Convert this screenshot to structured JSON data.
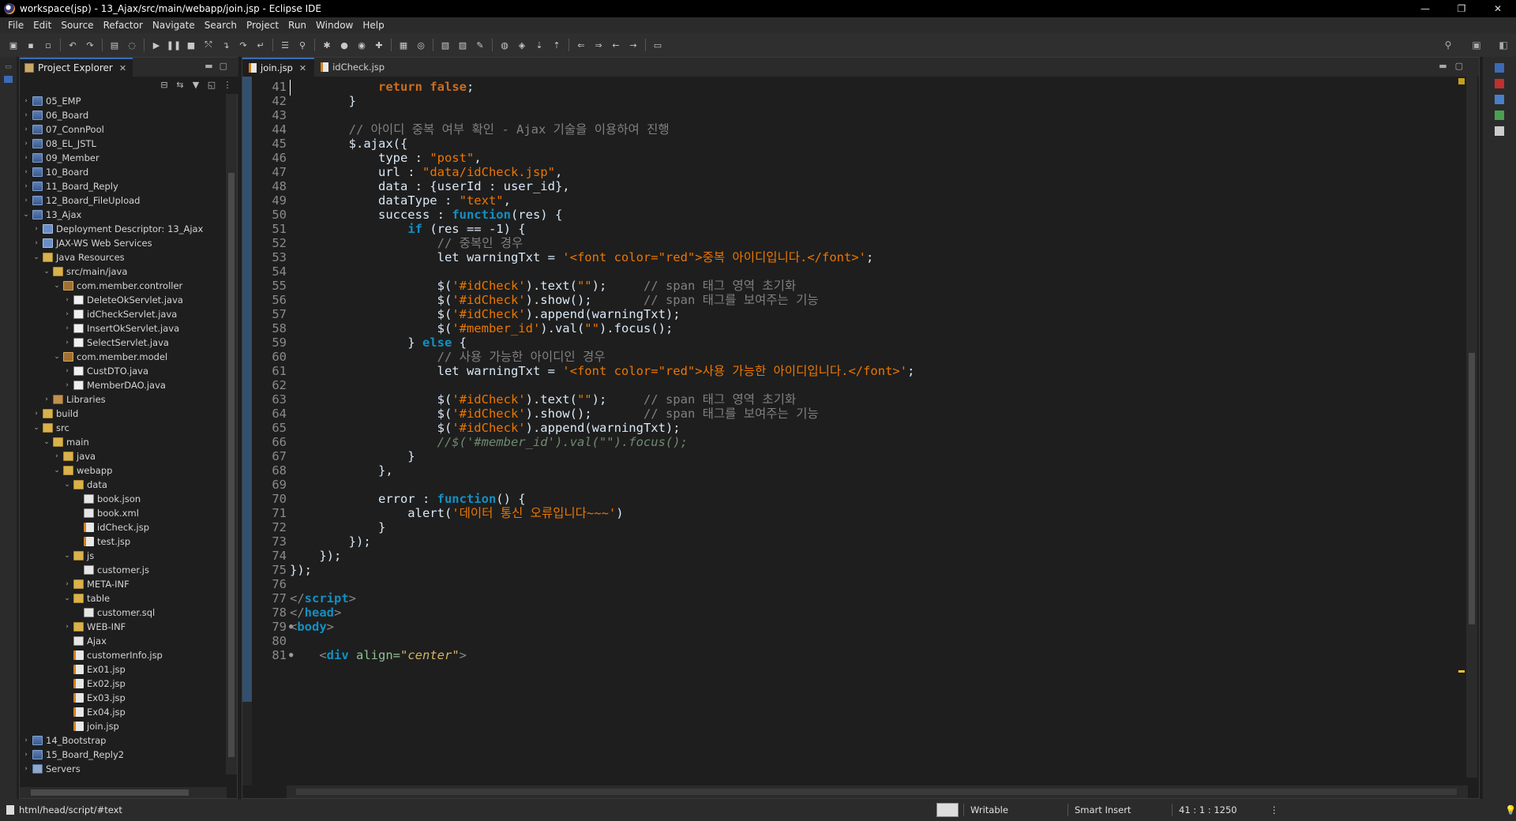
{
  "window": {
    "title": "workspace(jsp) - 13_Ajax/src/main/webapp/join.jsp - Eclipse IDE",
    "controls": [
      "—",
      "❐",
      "✕"
    ]
  },
  "menu": [
    "File",
    "Edit",
    "Source",
    "Refactor",
    "Navigate",
    "Search",
    "Project",
    "Run",
    "Window",
    "Help"
  ],
  "explorer": {
    "tab_label": "Project Explorer",
    "close": "✕",
    "tree": [
      {
        "label": "05_EMP",
        "depth": 0,
        "chev": "›",
        "icon": "project"
      },
      {
        "label": "06_Board",
        "depth": 0,
        "chev": "›",
        "icon": "project"
      },
      {
        "label": "07_ConnPool",
        "depth": 0,
        "chev": "›",
        "icon": "project"
      },
      {
        "label": "08_EL_JSTL",
        "depth": 0,
        "chev": "›",
        "icon": "project"
      },
      {
        "label": "09_Member",
        "depth": 0,
        "chev": "›",
        "icon": "project"
      },
      {
        "label": "10_Board",
        "depth": 0,
        "chev": "›",
        "icon": "project"
      },
      {
        "label": "11_Board_Reply",
        "depth": 0,
        "chev": "›",
        "icon": "project"
      },
      {
        "label": "12_Board_FileUpload",
        "depth": 0,
        "chev": "›",
        "icon": "project"
      },
      {
        "label": "13_Ajax",
        "depth": 0,
        "chev": "⌄",
        "icon": "project"
      },
      {
        "label": "Deployment Descriptor: 13_Ajax",
        "depth": 1,
        "chev": "›",
        "icon": "deploy"
      },
      {
        "label": "JAX-WS Web Services",
        "depth": 1,
        "chev": "›",
        "icon": "deploy"
      },
      {
        "label": "Java Resources",
        "depth": 1,
        "chev": "⌄",
        "icon": "folder"
      },
      {
        "label": "src/main/java",
        "depth": 2,
        "chev": "⌄",
        "icon": "folder"
      },
      {
        "label": "com.member.controller",
        "depth": 3,
        "chev": "⌄",
        "icon": "package"
      },
      {
        "label": "DeleteOkServlet.java",
        "depth": 4,
        "chev": "›",
        "icon": "java"
      },
      {
        "label": "idCheckServlet.java",
        "depth": 4,
        "chev": "›",
        "icon": "java"
      },
      {
        "label": "InsertOkServlet.java",
        "depth": 4,
        "chev": "›",
        "icon": "java"
      },
      {
        "label": "SelectServlet.java",
        "depth": 4,
        "chev": "›",
        "icon": "java"
      },
      {
        "label": "com.member.model",
        "depth": 3,
        "chev": "⌄",
        "icon": "package"
      },
      {
        "label": "CustDTO.java",
        "depth": 4,
        "chev": "›",
        "icon": "java"
      },
      {
        "label": "MemberDAO.java",
        "depth": 4,
        "chev": "›",
        "icon": "java"
      },
      {
        "label": "Libraries",
        "depth": 2,
        "chev": "›",
        "icon": "lib"
      },
      {
        "label": "build",
        "depth": 1,
        "chev": "›",
        "icon": "folder"
      },
      {
        "label": "src",
        "depth": 1,
        "chev": "⌄",
        "icon": "folder"
      },
      {
        "label": "main",
        "depth": 2,
        "chev": "⌄",
        "icon": "folder"
      },
      {
        "label": "java",
        "depth": 3,
        "chev": "›",
        "icon": "folder"
      },
      {
        "label": "webapp",
        "depth": 3,
        "chev": "⌄",
        "icon": "folder"
      },
      {
        "label": "data",
        "depth": 4,
        "chev": "⌄",
        "icon": "folder"
      },
      {
        "label": "book.json",
        "depth": 5,
        "chev": "",
        "icon": "file"
      },
      {
        "label": "book.xml",
        "depth": 5,
        "chev": "",
        "icon": "file"
      },
      {
        "label": "idCheck.jsp",
        "depth": 5,
        "chev": "",
        "icon": "jsp"
      },
      {
        "label": "test.jsp",
        "depth": 5,
        "chev": "",
        "icon": "jsp"
      },
      {
        "label": "js",
        "depth": 4,
        "chev": "⌄",
        "icon": "folder"
      },
      {
        "label": "customer.js",
        "depth": 5,
        "chev": "",
        "icon": "file"
      },
      {
        "label": "META-INF",
        "depth": 4,
        "chev": "›",
        "icon": "folder"
      },
      {
        "label": "table",
        "depth": 4,
        "chev": "⌄",
        "icon": "folder"
      },
      {
        "label": "customer.sql",
        "depth": 5,
        "chev": "",
        "icon": "file"
      },
      {
        "label": "WEB-INF",
        "depth": 4,
        "chev": "›",
        "icon": "folder"
      },
      {
        "label": "Ajax",
        "depth": 4,
        "chev": "",
        "icon": "file"
      },
      {
        "label": "customerInfo.jsp",
        "depth": 4,
        "chev": "",
        "icon": "jsp"
      },
      {
        "label": "Ex01.jsp",
        "depth": 4,
        "chev": "",
        "icon": "jsp"
      },
      {
        "label": "Ex02.jsp",
        "depth": 4,
        "chev": "",
        "icon": "jsp"
      },
      {
        "label": "Ex03.jsp",
        "depth": 4,
        "chev": "",
        "icon": "jsp"
      },
      {
        "label": "Ex04.jsp",
        "depth": 4,
        "chev": "",
        "icon": "jsp"
      },
      {
        "label": "join.jsp",
        "depth": 4,
        "chev": "",
        "icon": "jsp"
      },
      {
        "label": "14_Bootstrap",
        "depth": 0,
        "chev": "›",
        "icon": "project"
      },
      {
        "label": "15_Board_Reply2",
        "depth": 0,
        "chev": "›",
        "icon": "project"
      },
      {
        "label": "Servers",
        "depth": 0,
        "chev": "›",
        "icon": "servers"
      }
    ]
  },
  "editor": {
    "tabs": [
      {
        "label": "join.jsp",
        "active": true,
        "close": "✕"
      },
      {
        "label": "idCheck.jsp",
        "active": false,
        "close": ""
      }
    ],
    "lines": [
      {
        "n": "41",
        "fold": "",
        "t": [
          [
            "            ",
            "plain"
          ],
          [
            "return",
            "kw"
          ],
          [
            " ",
            "plain"
          ],
          [
            "false",
            "kw"
          ],
          [
            ";",
            "plain"
          ]
        ]
      },
      {
        "n": "42",
        "fold": "",
        "t": [
          [
            "        }",
            "plain"
          ]
        ]
      },
      {
        "n": "43",
        "fold": "",
        "t": []
      },
      {
        "n": "44",
        "fold": "",
        "t": [
          [
            "        // 아이디 중복 여부 확인 - Ajax 기술을 이용하여 진행",
            "cmt"
          ]
        ]
      },
      {
        "n": "45",
        "fold": "",
        "t": [
          [
            "        $.ajax({",
            "plain"
          ]
        ]
      },
      {
        "n": "46",
        "fold": "",
        "t": [
          [
            "            type : ",
            "plain"
          ],
          [
            "\"post\"",
            "jstr"
          ],
          [
            ",",
            "plain"
          ]
        ]
      },
      {
        "n": "47",
        "fold": "",
        "t": [
          [
            "            url : ",
            "plain"
          ],
          [
            "\"data/idCheck.jsp\"",
            "jstr"
          ],
          [
            ",",
            "plain"
          ]
        ]
      },
      {
        "n": "48",
        "fold": "",
        "t": [
          [
            "            data : {userId : user_id},",
            "plain"
          ]
        ]
      },
      {
        "n": "49",
        "fold": "",
        "t": [
          [
            "            dataType : ",
            "plain"
          ],
          [
            "\"text\"",
            "jstr"
          ],
          [
            ",",
            "plain"
          ]
        ]
      },
      {
        "n": "50",
        "fold": "",
        "t": [
          [
            "            success : ",
            "plain"
          ],
          [
            "function",
            "fn"
          ],
          [
            "(res) {",
            "plain"
          ]
        ]
      },
      {
        "n": "51",
        "fold": "",
        "t": [
          [
            "                ",
            "plain"
          ],
          [
            "if",
            "fn"
          ],
          [
            " (res == -1) {",
            "plain"
          ]
        ]
      },
      {
        "n": "52",
        "fold": "",
        "t": [
          [
            "                    // 중복인 경우",
            "cmt"
          ]
        ]
      },
      {
        "n": "53",
        "fold": "",
        "t": [
          [
            "                    let warningTxt = ",
            "plain"
          ],
          [
            "'<font color=\"red\">중복 아이디입니다.</font>'",
            "jstr"
          ],
          [
            ";",
            "plain"
          ]
        ]
      },
      {
        "n": "54",
        "fold": "",
        "t": []
      },
      {
        "n": "55",
        "fold": "",
        "t": [
          [
            "                    $(",
            "plain"
          ],
          [
            "'#idCheck'",
            "jstr"
          ],
          [
            ").text(",
            "plain"
          ],
          [
            "\"\"",
            "jstr"
          ],
          [
            ");     ",
            "plain"
          ],
          [
            "// span 태그 영역 초기화",
            "cmt"
          ]
        ]
      },
      {
        "n": "56",
        "fold": "",
        "t": [
          [
            "                    $(",
            "plain"
          ],
          [
            "'#idCheck'",
            "jstr"
          ],
          [
            ").show();       ",
            "plain"
          ],
          [
            "// span 태그를 보여주는 기능",
            "cmt"
          ]
        ]
      },
      {
        "n": "57",
        "fold": "",
        "t": [
          [
            "                    $(",
            "plain"
          ],
          [
            "'#idCheck'",
            "jstr"
          ],
          [
            ").append(warningTxt);",
            "plain"
          ]
        ]
      },
      {
        "n": "58",
        "fold": "",
        "t": [
          [
            "                    $(",
            "plain"
          ],
          [
            "'#member_id'",
            "jstr"
          ],
          [
            ").val(",
            "plain"
          ],
          [
            "\"\"",
            "jstr"
          ],
          [
            ").focus();",
            "plain"
          ]
        ]
      },
      {
        "n": "59",
        "fold": "",
        "t": [
          [
            "                } ",
            "plain"
          ],
          [
            "else",
            "fn"
          ],
          [
            " {",
            "plain"
          ]
        ]
      },
      {
        "n": "60",
        "fold": "",
        "t": [
          [
            "                    // 사용 가능한 아이디인 경우",
            "cmt"
          ]
        ]
      },
      {
        "n": "61",
        "fold": "",
        "t": [
          [
            "                    let warningTxt = ",
            "plain"
          ],
          [
            "'<font color=\"red\">사용 가능한 아이디입니다.</font>'",
            "jstr"
          ],
          [
            ";",
            "plain"
          ]
        ]
      },
      {
        "n": "62",
        "fold": "",
        "t": []
      },
      {
        "n": "63",
        "fold": "",
        "t": [
          [
            "                    $(",
            "plain"
          ],
          [
            "'#idCheck'",
            "jstr"
          ],
          [
            ").text(",
            "plain"
          ],
          [
            "\"\"",
            "jstr"
          ],
          [
            ");     ",
            "plain"
          ],
          [
            "// span 태그 영역 초기화",
            "cmt"
          ]
        ]
      },
      {
        "n": "64",
        "fold": "",
        "t": [
          [
            "                    $(",
            "plain"
          ],
          [
            "'#idCheck'",
            "jstr"
          ],
          [
            ").show();       ",
            "plain"
          ],
          [
            "// span 태그를 보여주는 기능",
            "cmt"
          ]
        ]
      },
      {
        "n": "65",
        "fold": "",
        "t": [
          [
            "                    $(",
            "plain"
          ],
          [
            "'#idCheck'",
            "jstr"
          ],
          [
            ").append(warningTxt);",
            "plain"
          ]
        ]
      },
      {
        "n": "66",
        "fold": "",
        "t": [
          [
            "                    //$('#member_id').val(\"\").focus();",
            "cmti"
          ]
        ]
      },
      {
        "n": "67",
        "fold": "",
        "t": [
          [
            "                }",
            "plain"
          ]
        ]
      },
      {
        "n": "68",
        "fold": "",
        "t": [
          [
            "            },",
            "plain"
          ]
        ]
      },
      {
        "n": "69",
        "fold": "",
        "t": []
      },
      {
        "n": "70",
        "fold": "",
        "t": [
          [
            "            error : ",
            "plain"
          ],
          [
            "function",
            "fn"
          ],
          [
            "() {",
            "plain"
          ]
        ]
      },
      {
        "n": "71",
        "fold": "",
        "t": [
          [
            "                alert(",
            "plain"
          ],
          [
            "'데이터 통신 오류입니다~~~'",
            "jstr"
          ],
          [
            ")",
            "plain"
          ]
        ]
      },
      {
        "n": "72",
        "fold": "",
        "t": [
          [
            "            }",
            "plain"
          ]
        ]
      },
      {
        "n": "73",
        "fold": "",
        "t": [
          [
            "        });",
            "plain"
          ]
        ]
      },
      {
        "n": "74",
        "fold": "",
        "t": [
          [
            "    });",
            "plain"
          ]
        ]
      },
      {
        "n": "75",
        "fold": "",
        "t": [
          [
            "});",
            "plain"
          ]
        ]
      },
      {
        "n": "76",
        "fold": "",
        "t": []
      },
      {
        "n": "77",
        "fold": "",
        "t": [
          [
            "</",
            "br"
          ],
          [
            "script",
            "tag"
          ],
          [
            ">",
            "br"
          ]
        ]
      },
      {
        "n": "78",
        "fold": "",
        "t": [
          [
            "</",
            "br"
          ],
          [
            "head",
            "tag"
          ],
          [
            ">",
            "br"
          ]
        ]
      },
      {
        "n": "79",
        "fold": "●",
        "t": [
          [
            "<",
            "br"
          ],
          [
            "body",
            "tag"
          ],
          [
            ">",
            "br"
          ]
        ]
      },
      {
        "n": "80",
        "fold": "",
        "t": []
      },
      {
        "n": "81",
        "fold": "●",
        "t": [
          [
            "    <",
            "br"
          ],
          [
            "div",
            "tag"
          ],
          [
            " ",
            "plain"
          ],
          [
            "align=",
            "attr"
          ],
          [
            "\"center\"",
            "aval"
          ],
          [
            ">",
            "br"
          ]
        ]
      }
    ]
  },
  "status": {
    "path": "html/head/script/#text",
    "writable": "Writable",
    "insert_mode": "Smart Insert",
    "position": "41 : 1 : 1250"
  }
}
